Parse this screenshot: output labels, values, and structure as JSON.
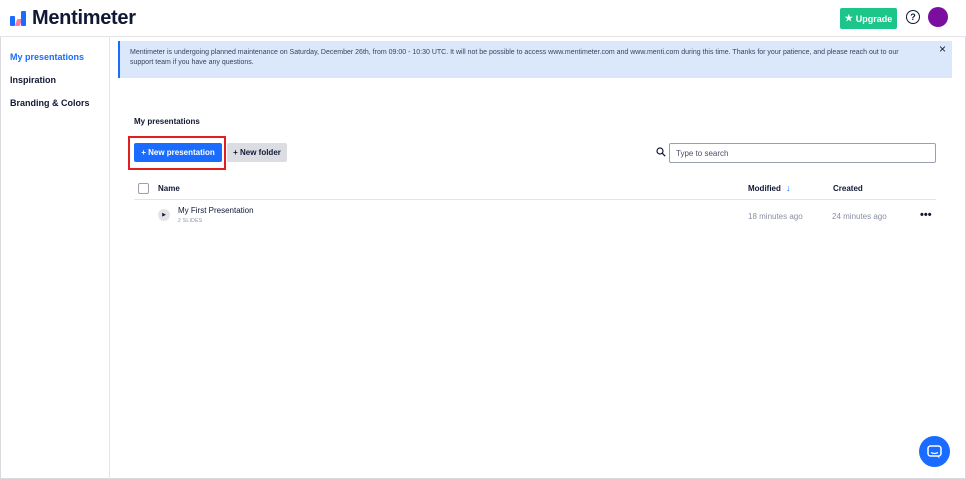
{
  "header": {
    "brand": "Mentimeter",
    "upgrade_label": "Upgrade",
    "upgrade_icon": "star-icon",
    "help_glyph": "?"
  },
  "sidebar": {
    "items": [
      {
        "label": "My presentations",
        "active": true
      },
      {
        "label": "Inspiration",
        "active": false
      },
      {
        "label": "Branding & Colors",
        "active": false
      }
    ]
  },
  "banner": {
    "text": "Mentimeter is undergoing planned maintenance on Saturday, December 26th, from 09:00 - 10:30 UTC. It will not be possible to access www.mentimeter.com and www.menti.com during this time. Thanks for your patience, and please reach out to our support team if you have any questions.",
    "close_glyph": "×"
  },
  "main": {
    "section_title": "My presentations",
    "new_presentation_label": "+ New presentation",
    "new_folder_label": "+ New folder",
    "search": {
      "placeholder": "Type to search",
      "value": ""
    },
    "columns": {
      "name": "Name",
      "modified": "Modified",
      "created": "Created"
    },
    "sort_glyph": "↓",
    "rows": [
      {
        "title": "My First Presentation",
        "subtitle": "2 SLIDES",
        "modified": "18 minutes ago",
        "created": "24 minutes ago"
      }
    ]
  },
  "colors": {
    "accent": "#196cff",
    "upgrade": "#1cc68b",
    "avatar": "#7b0e9f",
    "banner_bg": "#dbe8fb",
    "highlight": "#e02020"
  }
}
